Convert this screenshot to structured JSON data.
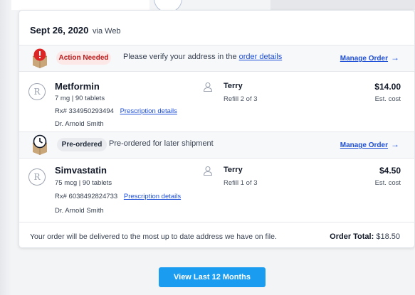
{
  "order": {
    "date": "Sept 26, 2020",
    "source": "via Web"
  },
  "sections": [
    {
      "status_badge": "Action Needed",
      "message_prefix": "Please verify your address in the",
      "message_link": "order details",
      "manage_label": "Manage Order",
      "item": {
        "drug_name": "Metformin",
        "dose": "7 mg | 90 tablets",
        "rx_number": "Rx# 334950293494",
        "rx_details_link": "Prescription details",
        "doctor": "Dr. Arnold Smith",
        "patient": "Terry",
        "refill": "Refill 2 of 3",
        "price": "$14.00",
        "price_note": "Est. cost"
      }
    },
    {
      "status_badge": "Pre-ordered",
      "message_prefix": "Pre-ordered for later shipment",
      "message_link": "",
      "manage_label": "Manage Order",
      "item": {
        "drug_name": "Simvastatin",
        "dose": "75 mcg | 90 tablets",
        "rx_number": "Rx# 6038492824733",
        "rx_details_link": "Prescription details",
        "doctor": "Dr. Arnold Smith",
        "patient": "Terry",
        "refill": "Refill 1 of 3",
        "price": "$4.50",
        "price_note": "Est. cost"
      }
    }
  ],
  "footer": {
    "delivery_note": "Your order will be delivered to the most up to date address we have on file.",
    "total_label": "Order Total:",
    "total_value": "$18.50"
  },
  "view_button_label": "View Last 12 Months",
  "icons": {
    "alert": "alert-box-icon",
    "clock": "clock-box-icon",
    "rx": "rx-icon",
    "person": "person-icon",
    "arrow": "arrow-right-icon"
  },
  "colors": {
    "link": "#1d4ed8",
    "alert_red": "#dc2626",
    "badge_alert_bg": "#fde8e8",
    "button_blue": "#1a9df0"
  }
}
